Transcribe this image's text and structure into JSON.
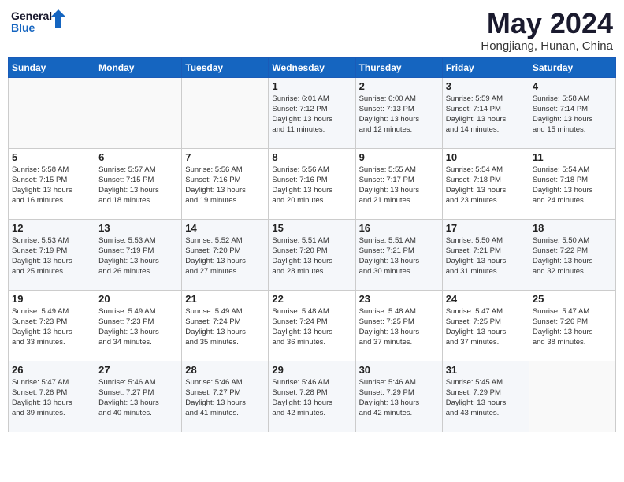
{
  "header": {
    "logo_line1": "General",
    "logo_line2": "Blue",
    "month_year": "May 2024",
    "location": "Hongjiang, Hunan, China"
  },
  "days_of_week": [
    "Sunday",
    "Monday",
    "Tuesday",
    "Wednesday",
    "Thursday",
    "Friday",
    "Saturday"
  ],
  "weeks": [
    [
      {
        "day": "",
        "info": ""
      },
      {
        "day": "",
        "info": ""
      },
      {
        "day": "",
        "info": ""
      },
      {
        "day": "1",
        "info": "Sunrise: 6:01 AM\nSunset: 7:12 PM\nDaylight: 13 hours\nand 11 minutes."
      },
      {
        "day": "2",
        "info": "Sunrise: 6:00 AM\nSunset: 7:13 PM\nDaylight: 13 hours\nand 12 minutes."
      },
      {
        "day": "3",
        "info": "Sunrise: 5:59 AM\nSunset: 7:14 PM\nDaylight: 13 hours\nand 14 minutes."
      },
      {
        "day": "4",
        "info": "Sunrise: 5:58 AM\nSunset: 7:14 PM\nDaylight: 13 hours\nand 15 minutes."
      }
    ],
    [
      {
        "day": "5",
        "info": "Sunrise: 5:58 AM\nSunset: 7:15 PM\nDaylight: 13 hours\nand 16 minutes."
      },
      {
        "day": "6",
        "info": "Sunrise: 5:57 AM\nSunset: 7:15 PM\nDaylight: 13 hours\nand 18 minutes."
      },
      {
        "day": "7",
        "info": "Sunrise: 5:56 AM\nSunset: 7:16 PM\nDaylight: 13 hours\nand 19 minutes."
      },
      {
        "day": "8",
        "info": "Sunrise: 5:56 AM\nSunset: 7:16 PM\nDaylight: 13 hours\nand 20 minutes."
      },
      {
        "day": "9",
        "info": "Sunrise: 5:55 AM\nSunset: 7:17 PM\nDaylight: 13 hours\nand 21 minutes."
      },
      {
        "day": "10",
        "info": "Sunrise: 5:54 AM\nSunset: 7:18 PM\nDaylight: 13 hours\nand 23 minutes."
      },
      {
        "day": "11",
        "info": "Sunrise: 5:54 AM\nSunset: 7:18 PM\nDaylight: 13 hours\nand 24 minutes."
      }
    ],
    [
      {
        "day": "12",
        "info": "Sunrise: 5:53 AM\nSunset: 7:19 PM\nDaylight: 13 hours\nand 25 minutes."
      },
      {
        "day": "13",
        "info": "Sunrise: 5:53 AM\nSunset: 7:19 PM\nDaylight: 13 hours\nand 26 minutes."
      },
      {
        "day": "14",
        "info": "Sunrise: 5:52 AM\nSunset: 7:20 PM\nDaylight: 13 hours\nand 27 minutes."
      },
      {
        "day": "15",
        "info": "Sunrise: 5:51 AM\nSunset: 7:20 PM\nDaylight: 13 hours\nand 28 minutes."
      },
      {
        "day": "16",
        "info": "Sunrise: 5:51 AM\nSunset: 7:21 PM\nDaylight: 13 hours\nand 30 minutes."
      },
      {
        "day": "17",
        "info": "Sunrise: 5:50 AM\nSunset: 7:21 PM\nDaylight: 13 hours\nand 31 minutes."
      },
      {
        "day": "18",
        "info": "Sunrise: 5:50 AM\nSunset: 7:22 PM\nDaylight: 13 hours\nand 32 minutes."
      }
    ],
    [
      {
        "day": "19",
        "info": "Sunrise: 5:49 AM\nSunset: 7:23 PM\nDaylight: 13 hours\nand 33 minutes."
      },
      {
        "day": "20",
        "info": "Sunrise: 5:49 AM\nSunset: 7:23 PM\nDaylight: 13 hours\nand 34 minutes."
      },
      {
        "day": "21",
        "info": "Sunrise: 5:49 AM\nSunset: 7:24 PM\nDaylight: 13 hours\nand 35 minutes."
      },
      {
        "day": "22",
        "info": "Sunrise: 5:48 AM\nSunset: 7:24 PM\nDaylight: 13 hours\nand 36 minutes."
      },
      {
        "day": "23",
        "info": "Sunrise: 5:48 AM\nSunset: 7:25 PM\nDaylight: 13 hours\nand 37 minutes."
      },
      {
        "day": "24",
        "info": "Sunrise: 5:47 AM\nSunset: 7:25 PM\nDaylight: 13 hours\nand 37 minutes."
      },
      {
        "day": "25",
        "info": "Sunrise: 5:47 AM\nSunset: 7:26 PM\nDaylight: 13 hours\nand 38 minutes."
      }
    ],
    [
      {
        "day": "26",
        "info": "Sunrise: 5:47 AM\nSunset: 7:26 PM\nDaylight: 13 hours\nand 39 minutes."
      },
      {
        "day": "27",
        "info": "Sunrise: 5:46 AM\nSunset: 7:27 PM\nDaylight: 13 hours\nand 40 minutes."
      },
      {
        "day": "28",
        "info": "Sunrise: 5:46 AM\nSunset: 7:27 PM\nDaylight: 13 hours\nand 41 minutes."
      },
      {
        "day": "29",
        "info": "Sunrise: 5:46 AM\nSunset: 7:28 PM\nDaylight: 13 hours\nand 42 minutes."
      },
      {
        "day": "30",
        "info": "Sunrise: 5:46 AM\nSunset: 7:29 PM\nDaylight: 13 hours\nand 42 minutes."
      },
      {
        "day": "31",
        "info": "Sunrise: 5:45 AM\nSunset: 7:29 PM\nDaylight: 13 hours\nand 43 minutes."
      },
      {
        "day": "",
        "info": ""
      }
    ]
  ]
}
